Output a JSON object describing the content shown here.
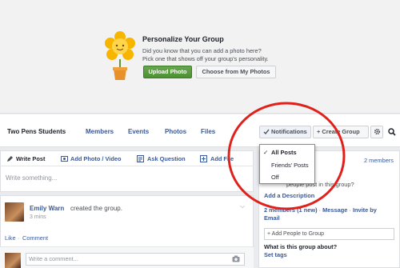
{
  "cover": {
    "title": "Personalize Your Group",
    "line1": "Did you know that you can add a photo here?",
    "line2": "Pick one that shows off your group's personality.",
    "upload_label": "Upload Photo",
    "choose_label": "Choose from My Photos"
  },
  "nav": {
    "group_name": "Two Pens Students",
    "members": "Members",
    "events": "Events",
    "photos": "Photos",
    "files": "Files",
    "notifications": "Notifications",
    "create_group": "+ Create Group"
  },
  "dropdown": {
    "items": [
      "All Posts",
      "Friends' Posts",
      "Off"
    ],
    "selected": "All Posts"
  },
  "composer": {
    "tabs": [
      "Write Post",
      "Add Photo / Video",
      "Ask Question",
      "Add File"
    ],
    "placeholder": "Write something..."
  },
  "post": {
    "author": "Emily Warn",
    "action": "created the group.",
    "time": "3 mins",
    "like": "Like",
    "separator": "·",
    "comment": "Comment",
    "comment_placeholder": "Write a comment..."
  },
  "sidebar": {
    "members_count": "2 members",
    "add_people_question": "people post in this group?",
    "add_description": "Add a Description",
    "members_new": "2 members (1 new)",
    "message": "Message",
    "invite_by": "Invite by",
    "email": "Email",
    "add_people_placeholder": "+ Add People to Group",
    "about_question": "What is this group about?",
    "set_tags": "Set tags"
  },
  "colors": {
    "link_blue": "#3b5998",
    "upload_green": "#4d9133",
    "annotation_red": "#e0201b"
  }
}
